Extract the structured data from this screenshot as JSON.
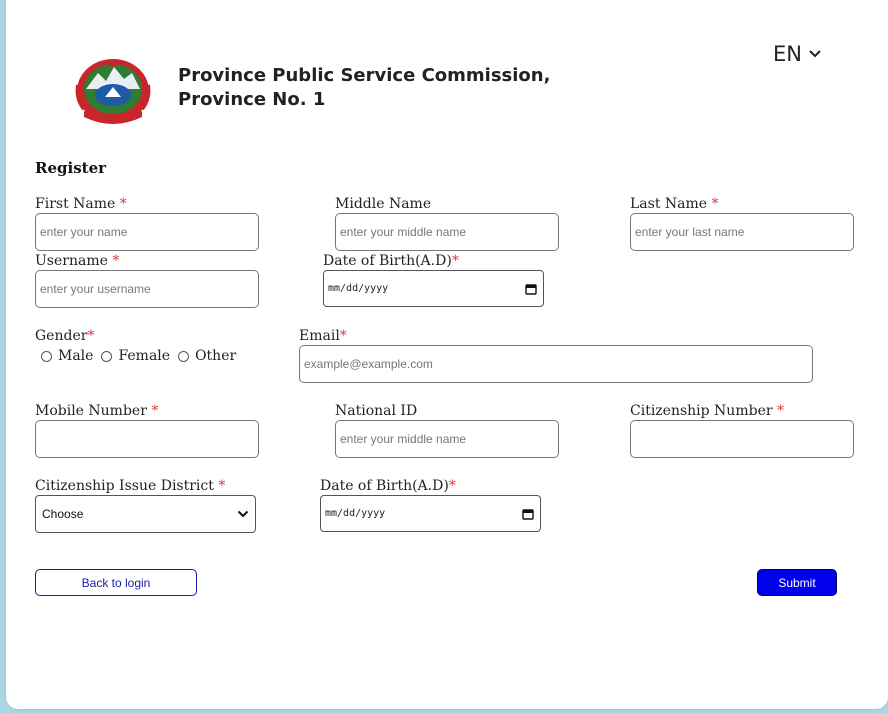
{
  "header": {
    "org_line1": "Province Public Service Commission,",
    "org_line2": "Province No. 1",
    "language": "EN"
  },
  "form": {
    "title": "Register",
    "required_mark": "*",
    "first_name": {
      "label": "First Name",
      "placeholder": "enter your name"
    },
    "middle_name": {
      "label": "Middle Name",
      "placeholder": "enter your middle name"
    },
    "last_name": {
      "label": "Last Name",
      "placeholder": "enter your last name"
    },
    "username": {
      "label": "Username",
      "placeholder": "enter your username"
    },
    "dob1": {
      "label": "Date of Birth(A.D)",
      "value": "mm/dd/yyyy"
    },
    "gender": {
      "label": "Gender",
      "options": [
        "Male",
        "Female",
        "Other"
      ]
    },
    "email": {
      "label": "Email",
      "placeholder": "example@example.com"
    },
    "mobile": {
      "label": "Mobile Number",
      "placeholder": ""
    },
    "national_id": {
      "label": "National ID",
      "placeholder": "enter your middle name"
    },
    "citizenship_number": {
      "label": "Citizenship Number",
      "placeholder": ""
    },
    "district": {
      "label": "Citizenship Issue District",
      "selected": "Choose"
    },
    "dob2": {
      "label": "Date of Birth(A.D)",
      "value": "mm/dd/yyyy"
    }
  },
  "buttons": {
    "back": "Back to login",
    "submit": "Submit"
  },
  "colors": {
    "page_bg": "#a9d6e0",
    "required": "#e0343b",
    "submit_bg": "#0000ee",
    "back_border": "#1a1aa8"
  }
}
